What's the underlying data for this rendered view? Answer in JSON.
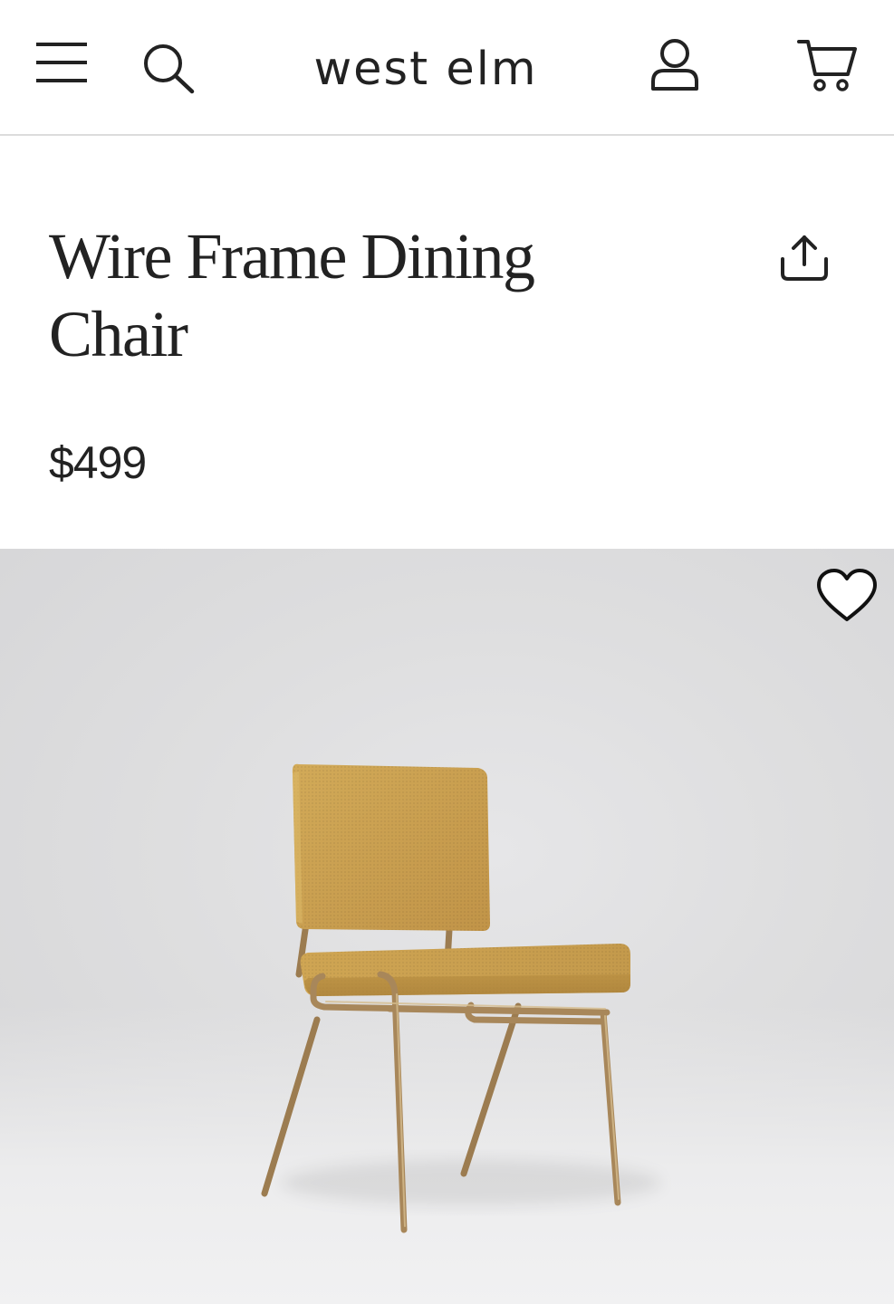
{
  "header": {
    "brand": "west elm",
    "icons": {
      "menu": "menu-icon",
      "search": "search-icon",
      "account": "account-icon",
      "cart": "cart-icon"
    }
  },
  "product": {
    "title": "Wire Frame Dining Chair",
    "price": "$499",
    "share_icon": "share-icon",
    "wishlist_icon": "heart-icon"
  },
  "colors": {
    "text": "#222222",
    "divider": "#dcdcdc",
    "background": "#ffffff",
    "upholstery": "#c9a04e",
    "frame": "#a8875a"
  }
}
